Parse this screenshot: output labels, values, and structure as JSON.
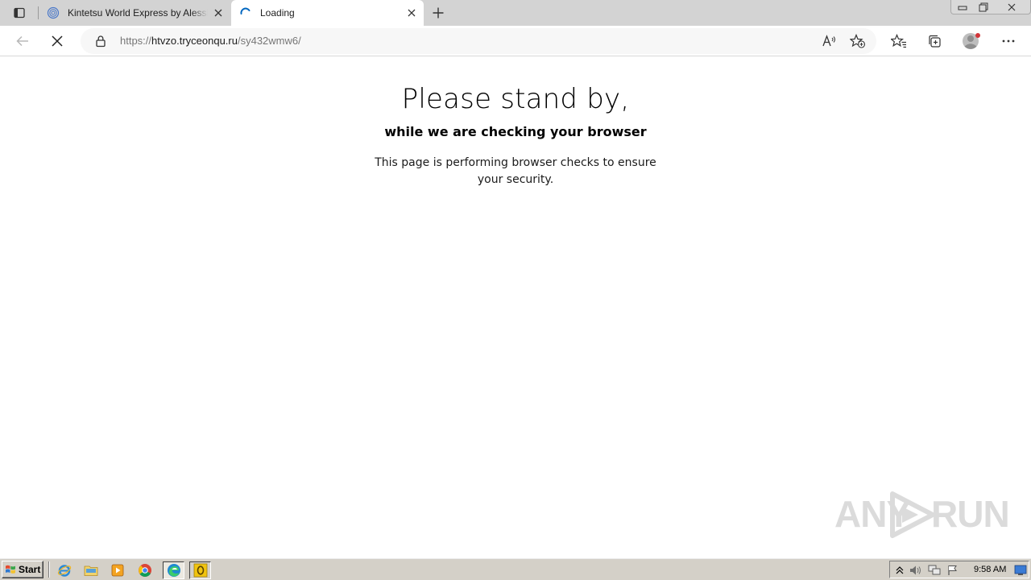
{
  "browser": {
    "tabs": [
      {
        "title": "Kintetsu World Express by Alessia",
        "favicon": "globe-icon",
        "active": false
      },
      {
        "title": "Loading",
        "favicon": "loading-spinner-icon",
        "active": true
      }
    ],
    "address": {
      "scheme": "https://",
      "host": "htvzo.tryceonqu.ru",
      "path": "/sy432wmw6/"
    }
  },
  "page": {
    "headline": "Please stand by,",
    "subhead": "while we are checking your browser",
    "body": "This page is performing browser checks to ensure your security."
  },
  "watermark": {
    "left": "ANY",
    "right": "RUN"
  },
  "taskbar": {
    "start_label": "Start",
    "quick_launch": [
      "internet-explorer-icon",
      "folder-icon",
      "media-player-icon",
      "chrome-icon",
      "edge-icon",
      "outlook-icon"
    ],
    "clock": "9:58 AM"
  },
  "colors": {
    "tabbar_bg": "#d3d3d3",
    "taskbar_bg": "#d4d0c8",
    "accent_blue": "#0067c0",
    "profile_badge": "#d13438"
  }
}
